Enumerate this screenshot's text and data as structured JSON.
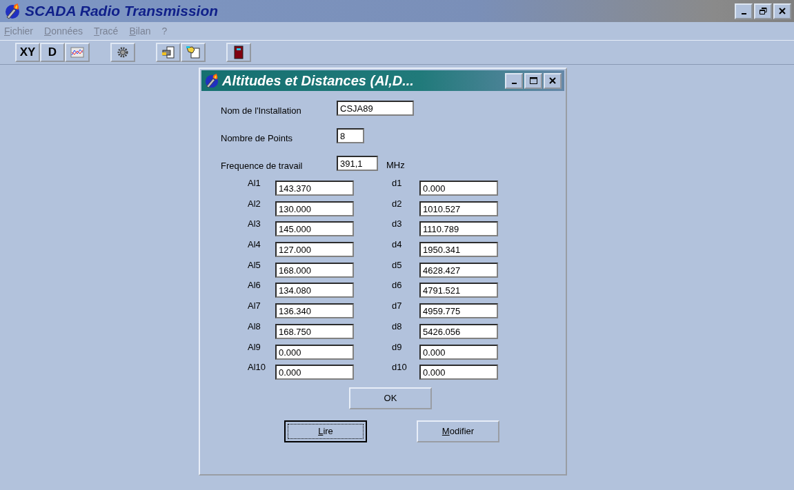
{
  "window": {
    "title": "SCADA Radio Transmission"
  },
  "menu": [
    "Fichier",
    "Données",
    "Tracé",
    "Bilan",
    "?"
  ],
  "toolbar": [
    {
      "kind": "text",
      "label": "XY"
    },
    {
      "kind": "text",
      "label": "D"
    },
    {
      "kind": "chart"
    },
    {
      "kind": "gap"
    },
    {
      "kind": "gear"
    },
    {
      "kind": "gap"
    },
    {
      "kind": "print"
    },
    {
      "kind": "hand"
    },
    {
      "kind": "gap"
    },
    {
      "kind": "door"
    }
  ],
  "dialog": {
    "title": "Altitudes et Distances (Al,D...",
    "fields": [
      {
        "label": "Nom de l'Installation",
        "value": "CSJA89"
      },
      {
        "label": "Nombre de Points",
        "value": "8"
      },
      {
        "label": "Frequence de travail",
        "value": "391,1",
        "unit": "MHz"
      }
    ],
    "altitudes": [
      {
        "label": "Al1",
        "value": "143.370"
      },
      {
        "label": "Al2",
        "value": "130.000"
      },
      {
        "label": "Al3",
        "value": "145.000"
      },
      {
        "label": "Al4",
        "value": "127.000"
      },
      {
        "label": "Al5",
        "value": "168.000"
      },
      {
        "label": "Al6",
        "value": "134.080"
      },
      {
        "label": "Al7",
        "value": "136.340"
      },
      {
        "label": "Al8",
        "value": "168.750"
      },
      {
        "label": "Al9",
        "value": "0.000"
      },
      {
        "label": "Al10",
        "value": "0.000"
      }
    ],
    "distances": [
      {
        "label": "d1",
        "value": "0.000"
      },
      {
        "label": "d2",
        "value": "1010.527"
      },
      {
        "label": "d3",
        "value": "1110.789"
      },
      {
        "label": "d4",
        "value": "1950.341"
      },
      {
        "label": "d5",
        "value": "4628.427"
      },
      {
        "label": "d6",
        "value": "4791.521"
      },
      {
        "label": "d7",
        "value": "4959.775"
      },
      {
        "label": "d8",
        "value": "5426.056"
      },
      {
        "label": "d9",
        "value": "0.000"
      },
      {
        "label": "d10",
        "value": "0.000"
      }
    ],
    "ok_button": "OK",
    "buttons": [
      {
        "label": "Lire",
        "focused": true
      },
      {
        "label": "Modifier",
        "focused": false
      }
    ]
  }
}
